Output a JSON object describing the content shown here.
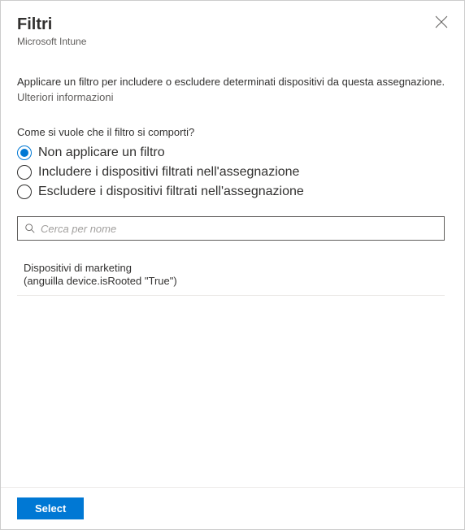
{
  "header": {
    "title": "Filtri",
    "subtitle": "Microsoft Intune"
  },
  "description": "Applicare un filtro per includere o escludere determinati dispositivi da questa assegnazione.",
  "learn_more": "Ulteriori informazioni",
  "question": "Come si vuole che il filtro si comporti?",
  "radios": [
    {
      "label": "Non applicare un filtro",
      "selected": true
    },
    {
      "label": "Includere i dispositivi filtrati nell'assegnazione",
      "selected": false
    },
    {
      "label": "Escludere i dispositivi filtrati nell'assegnazione",
      "selected": false
    }
  ],
  "search": {
    "placeholder": "Cerca per nome"
  },
  "items": [
    {
      "title": "Dispositivi di marketing",
      "sub": "(anguilla device.isRooted \"True\")"
    }
  ],
  "footer": {
    "select_label": "Select"
  }
}
